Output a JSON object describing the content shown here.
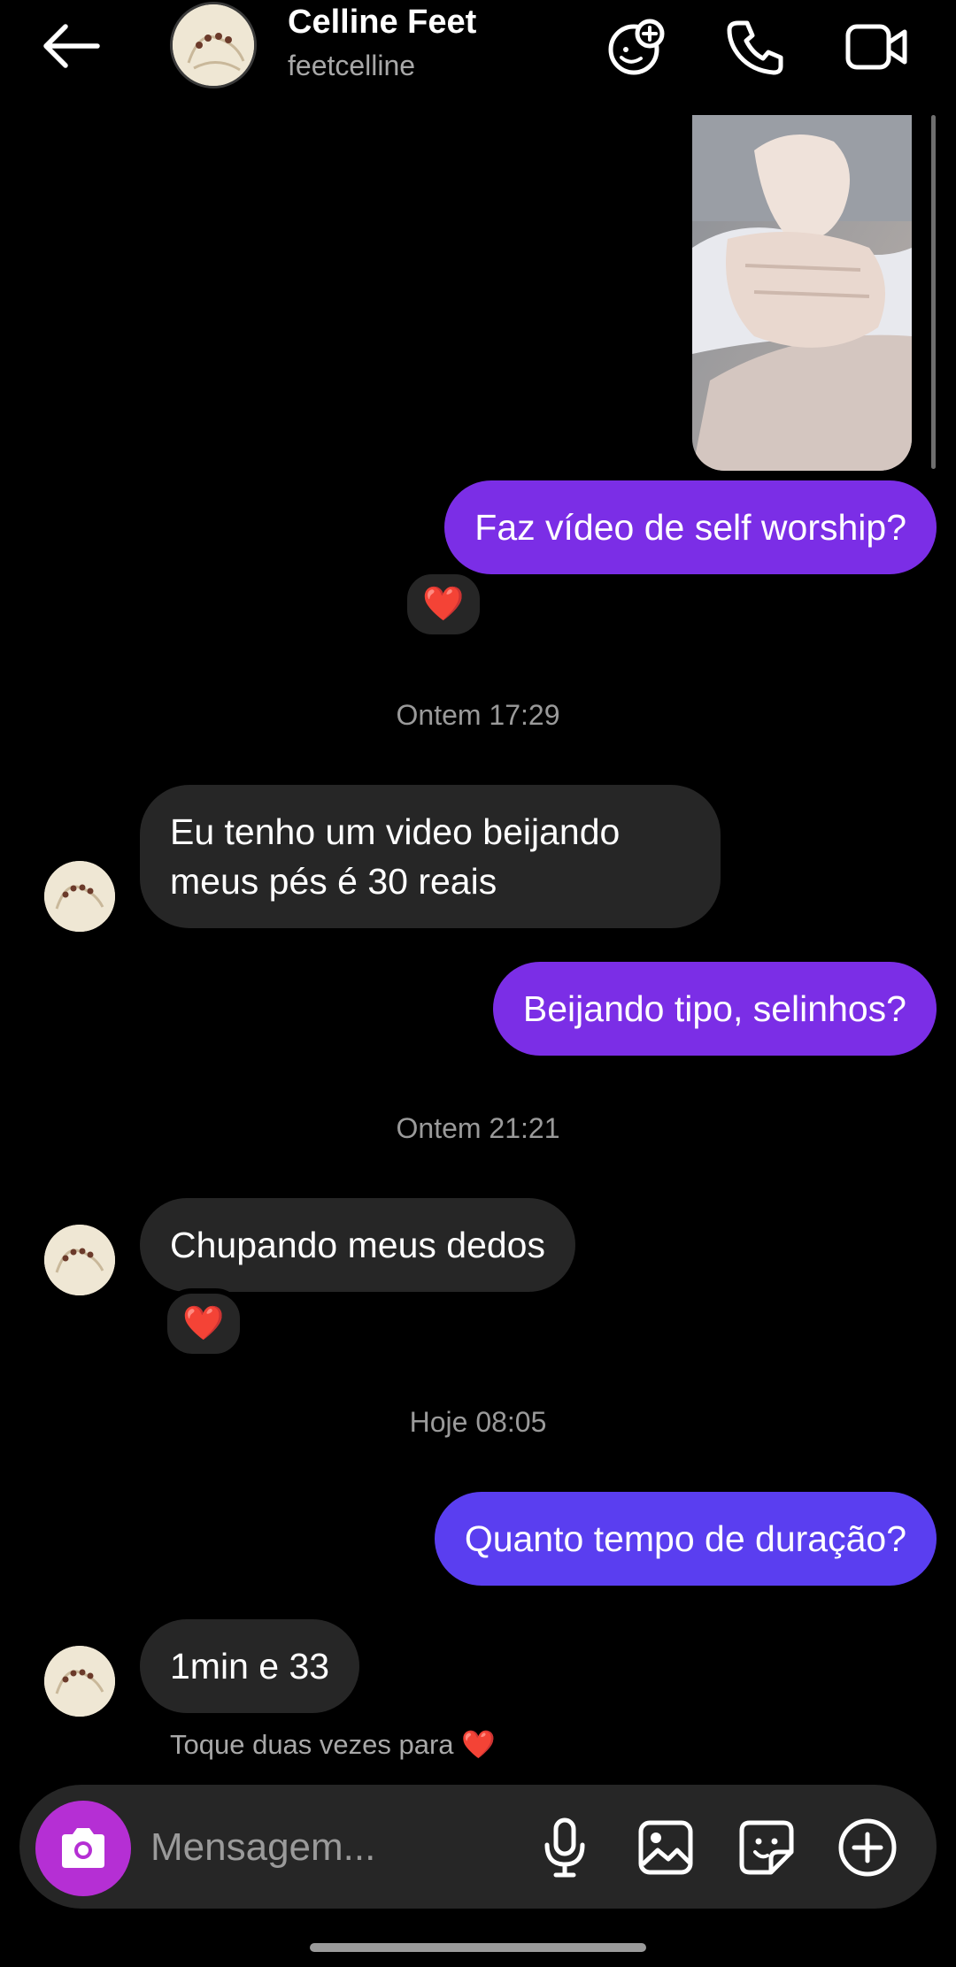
{
  "header": {
    "title": "Celline Feet",
    "username": "feetcelline",
    "icons": [
      "back-arrow-icon",
      "add-sticker-icon",
      "phone-icon",
      "video-icon"
    ]
  },
  "messages": [
    {
      "type": "outgoing",
      "text": "Faz vídeo de self worship?",
      "reaction": "❤️"
    },
    {
      "type": "timestamp",
      "text": "Ontem 17:29"
    },
    {
      "type": "incoming",
      "lines": [
        "Eu tenho um video beijando",
        "meus pés é 30 reais"
      ]
    },
    {
      "type": "outgoing",
      "text": "Beijando tipo, selinhos?"
    },
    {
      "type": "timestamp",
      "text": "Ontem 21:21"
    },
    {
      "type": "incoming",
      "text": "Chupando meus dedos",
      "reaction": "❤️"
    },
    {
      "type": "timestamp",
      "text": "Hoje 08:05"
    },
    {
      "type": "outgoing",
      "text": "Quanto tempo de duração?"
    },
    {
      "type": "incoming",
      "text": "1min e 33"
    }
  ],
  "hint": {
    "text": "Toque duas vezes para",
    "heart": "❤️"
  },
  "composer": {
    "placeholder": "Mensagem..."
  },
  "colors": {
    "outgoing": "#7b2ee6",
    "outgoing_last": "#5a3ef0",
    "incoming": "#262626",
    "camera": "#b52fd4"
  }
}
